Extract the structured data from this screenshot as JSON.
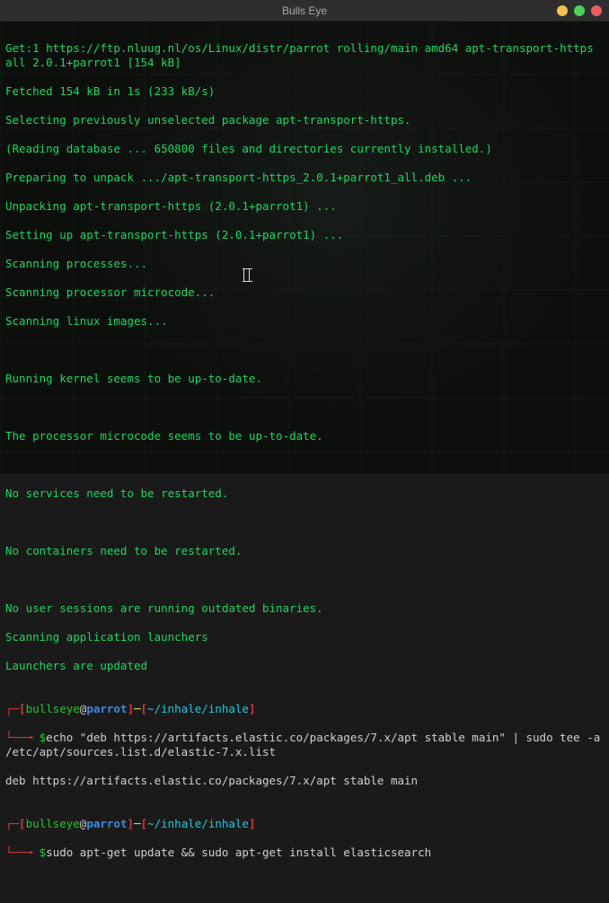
{
  "window": {
    "title": "Bulls Eye"
  },
  "colors": {
    "green": "#1ed760",
    "red": "#d33a3a",
    "blue": "#3a8de0",
    "cyan": "#1fcadf",
    "yellow": "#f0d84a",
    "white": "#d0d0d0"
  },
  "output": {
    "l0": "Get:1 https://ftp.nluug.nl/os/Linux/distr/parrot rolling/main amd64 apt-transport-https all 2.0.1+parrot1 [154 kB]",
    "l1": "Fetched 154 kB in 1s (233 kB/s)",
    "l2": "Selecting previously unselected package apt-transport-https.",
    "l3": "(Reading database ... 650800 files and directories currently installed.)",
    "l4": "Preparing to unpack .../apt-transport-https_2.0.1+parrot1_all.deb ...",
    "l5": "Unpacking apt-transport-https (2.0.1+parrot1) ...",
    "l6": "Setting up apt-transport-https (2.0.1+parrot1) ...",
    "l7": "Scanning processes...",
    "l8": "Scanning processor microcode...",
    "l9": "Scanning linux images...",
    "blank1": "",
    "l10": "Running kernel seems to be up-to-date.",
    "blank2": "",
    "l11": "The processor microcode seems to be up-to-date.",
    "blank3": "",
    "l12": "No services need to be restarted.",
    "blank4": "",
    "l13": "No containers need to be restarted.",
    "blank5": "",
    "l14": "No user sessions are running outdated binaries.",
    "l15": "Scanning application launchers",
    "l16": "Launchers are updated"
  },
  "prompt": {
    "lbracket": "┌─[",
    "user": "bullseye",
    "at": "@",
    "host": "parrot",
    "rbracket": "]",
    "dash": "─",
    "lbracket2": "[",
    "path": "~/inhale/inhale",
    "rbracket2": "]",
    "line2prefix": "└──╼ ",
    "dollar": "$"
  },
  "cmd1": {
    "text": "echo \"deb https://artifacts.elastic.co/packages/7.x/apt stable main\" | sudo tee -a /etc/apt/sources.list.d/elastic-7.x.list"
  },
  "cmd1_output": "deb https://artifacts.elastic.co/packages/7.x/apt stable main",
  "cmd2": {
    "text": "sudo apt-get update && sudo apt-get install elasticsearch"
  }
}
